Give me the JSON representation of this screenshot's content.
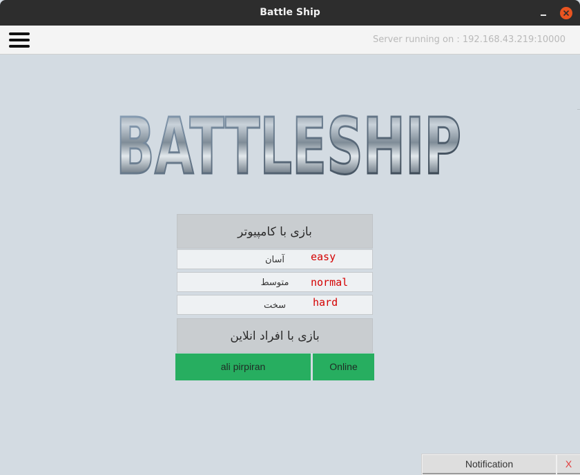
{
  "window": {
    "title": "Battle Ship"
  },
  "toolbar": {
    "menu_icon": "hamburger-icon",
    "server_status": "Server running on : 192.168.43.219:10000"
  },
  "logo": {
    "text": "BATTLESHIP"
  },
  "menu": {
    "play_computer": "بازی با کامپیوتر",
    "difficulties": [
      {
        "fa": "آسان",
        "en": "easy"
      },
      {
        "fa": "متوسط",
        "en": "normal"
      },
      {
        "fa": "سخت",
        "en": "hard"
      }
    ],
    "play_online": "بازی با افراد انلاین"
  },
  "online_user": {
    "name": "ali pirpiran",
    "status": "Online"
  },
  "notification": {
    "label": "Notification",
    "close": "X"
  },
  "colors": {
    "background": "#d3dbe2",
    "online_green": "#27ae60",
    "accent_red": "#d40000",
    "titlebar": "#2d2d2d",
    "close_orange": "#e95420"
  }
}
